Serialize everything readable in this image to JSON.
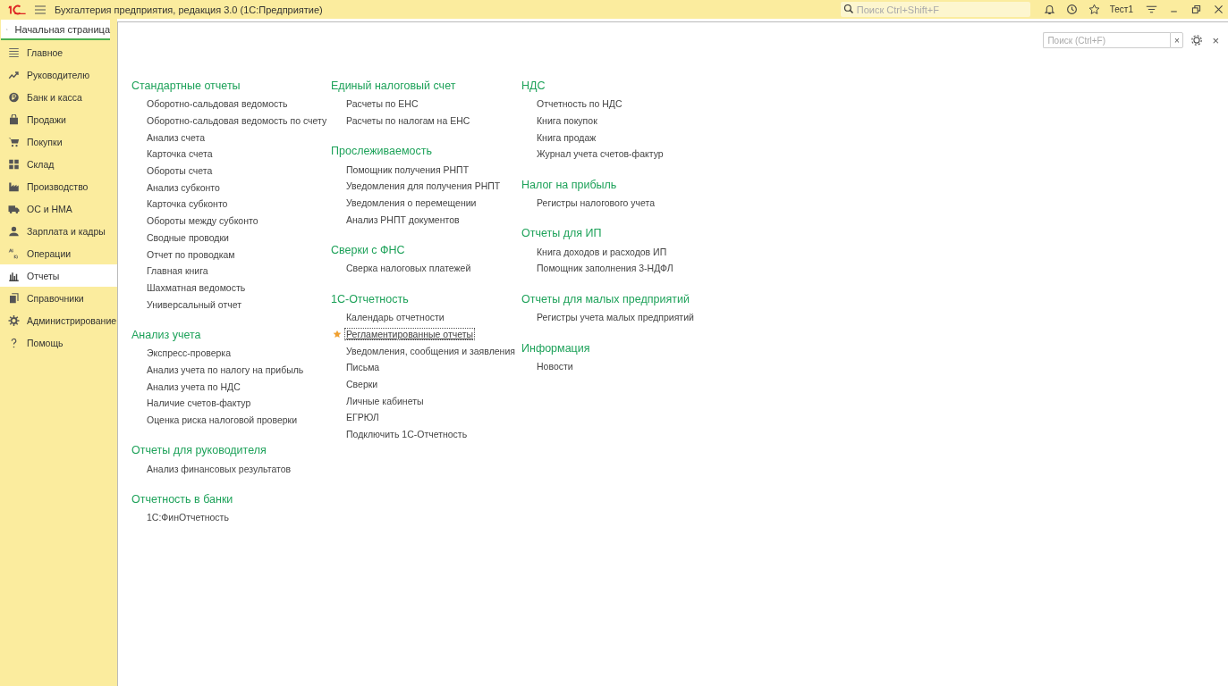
{
  "window": {
    "title": "Бухгалтерия предприятия, редакция 3.0  (1С:Предприятие)",
    "search_placeholder": "Поиск Ctrl+Shift+F",
    "user": "Тест1"
  },
  "home_tab": {
    "label": "Начальная страница",
    "selected": true
  },
  "sidebar": {
    "items": [
      {
        "label": "Главное",
        "selected": false
      },
      {
        "label": "Руководителю",
        "selected": false
      },
      {
        "label": "Банк и касса",
        "selected": false
      },
      {
        "label": "Продажи",
        "selected": false
      },
      {
        "label": "Покупки",
        "selected": false
      },
      {
        "label": "Склад",
        "selected": false
      },
      {
        "label": "Производство",
        "selected": false
      },
      {
        "label": "ОС и НМА",
        "selected": false
      },
      {
        "label": "Зарплата и кадры",
        "selected": false
      },
      {
        "label": "Операции",
        "selected": false
      },
      {
        "label": "Отчеты",
        "selected": true
      },
      {
        "label": "Справочники",
        "selected": false
      },
      {
        "label": "Администрирование",
        "selected": false
      },
      {
        "label": "Помощь",
        "selected": false
      }
    ]
  },
  "panel": {
    "search_placeholder": "Поиск (Ctrl+F)",
    "clear": "×",
    "close": "×"
  },
  "columns": [
    [
      {
        "heading": "Стандартные отчеты",
        "items": [
          {
            "label": "Оборотно-сальдовая ведомость",
            "favorite": false,
            "selected": false
          },
          {
            "label": "Оборотно-сальдовая ведомость по счету",
            "favorite": false,
            "selected": false
          },
          {
            "label": "Анализ счета",
            "favorite": false,
            "selected": false
          },
          {
            "label": "Карточка счета",
            "favorite": false,
            "selected": false
          },
          {
            "label": "Обороты счета",
            "favorite": false,
            "selected": false
          },
          {
            "label": "Анализ субконто",
            "favorite": false,
            "selected": false
          },
          {
            "label": "Карточка субконто",
            "favorite": false,
            "selected": false
          },
          {
            "label": "Обороты между субконто",
            "favorite": false,
            "selected": false
          },
          {
            "label": "Сводные проводки",
            "favorite": false,
            "selected": false
          },
          {
            "label": "Отчет по проводкам",
            "favorite": false,
            "selected": false
          },
          {
            "label": "Главная книга",
            "favorite": false,
            "selected": false
          },
          {
            "label": "Шахматная ведомость",
            "favorite": false,
            "selected": false
          },
          {
            "label": "Универсальный отчет",
            "favorite": false,
            "selected": false
          }
        ]
      },
      {
        "heading": "Анализ учета",
        "items": [
          {
            "label": "Экспресс-проверка",
            "favorite": false,
            "selected": false
          },
          {
            "label": "Анализ учета по налогу на прибыль",
            "favorite": false,
            "selected": false
          },
          {
            "label": "Анализ учета по НДС",
            "favorite": false,
            "selected": false
          },
          {
            "label": "Наличие счетов-фактур",
            "favorite": false,
            "selected": false
          },
          {
            "label": "Оценка риска налоговой проверки",
            "favorite": false,
            "selected": false
          }
        ]
      },
      {
        "heading": "Отчеты для руководителя",
        "items": [
          {
            "label": "Анализ финансовых результатов",
            "favorite": false,
            "selected": false
          }
        ]
      },
      {
        "heading": "Отчетность в банки",
        "items": [
          {
            "label": "1С:ФинОтчетность",
            "favorite": false,
            "selected": false
          }
        ]
      }
    ],
    [
      {
        "heading": "Единый налоговый счет",
        "items": [
          {
            "label": "Расчеты по ЕНС",
            "favorite": false,
            "selected": false
          },
          {
            "label": "Расчеты по налогам на ЕНС",
            "favorite": false,
            "selected": false
          }
        ]
      },
      {
        "heading": "Прослеживаемость",
        "items": [
          {
            "label": "Помощник получения РНПТ",
            "favorite": false,
            "selected": false
          },
          {
            "label": "Уведомления для получения РНПТ",
            "favorite": false,
            "selected": false
          },
          {
            "label": "Уведомления о перемещении",
            "favorite": false,
            "selected": false
          },
          {
            "label": "Анализ РНПТ документов",
            "favorite": false,
            "selected": false
          }
        ]
      },
      {
        "heading": "Сверки с ФНС",
        "items": [
          {
            "label": "Сверка налоговых платежей",
            "favorite": false,
            "selected": false
          }
        ]
      },
      {
        "heading": "1С-Отчетность",
        "items": [
          {
            "label": "Календарь отчетности",
            "favorite": false,
            "selected": false
          },
          {
            "label": "Регламентированные отчеты",
            "favorite": true,
            "selected": true
          },
          {
            "label": "Уведомления, сообщения и заявления",
            "favorite": false,
            "selected": false
          },
          {
            "label": "Письма",
            "favorite": false,
            "selected": false
          },
          {
            "label": "Сверки",
            "favorite": false,
            "selected": false
          },
          {
            "label": "Личные кабинеты",
            "favorite": false,
            "selected": false
          },
          {
            "label": "ЕГРЮЛ",
            "favorite": false,
            "selected": false
          },
          {
            "label": "Подключить 1С-Отчетность",
            "favorite": false,
            "selected": false
          }
        ]
      }
    ],
    [
      {
        "heading": "НДС",
        "items": [
          {
            "label": "Отчетность по НДС",
            "favorite": false,
            "selected": false
          },
          {
            "label": "Книга покупок",
            "favorite": false,
            "selected": false
          },
          {
            "label": "Книга продаж",
            "favorite": false,
            "selected": false
          },
          {
            "label": "Журнал учета счетов-фактур",
            "favorite": false,
            "selected": false
          }
        ]
      },
      {
        "heading": "Налог на прибыль",
        "items": [
          {
            "label": "Регистры налогового учета",
            "favorite": false,
            "selected": false
          }
        ]
      },
      {
        "heading": "Отчеты для ИП",
        "items": [
          {
            "label": "Книга доходов и расходов ИП",
            "favorite": false,
            "selected": false
          },
          {
            "label": "Помощник заполнения 3-НДФЛ",
            "favorite": false,
            "selected": false
          }
        ]
      },
      {
        "heading": "Отчеты для малых предприятий",
        "items": [
          {
            "label": "Регистры учета малых предприятий",
            "favorite": false,
            "selected": false
          }
        ]
      },
      {
        "heading": "Информация",
        "items": [
          {
            "label": "Новости",
            "favorite": false,
            "selected": false
          }
        ]
      }
    ]
  ]
}
